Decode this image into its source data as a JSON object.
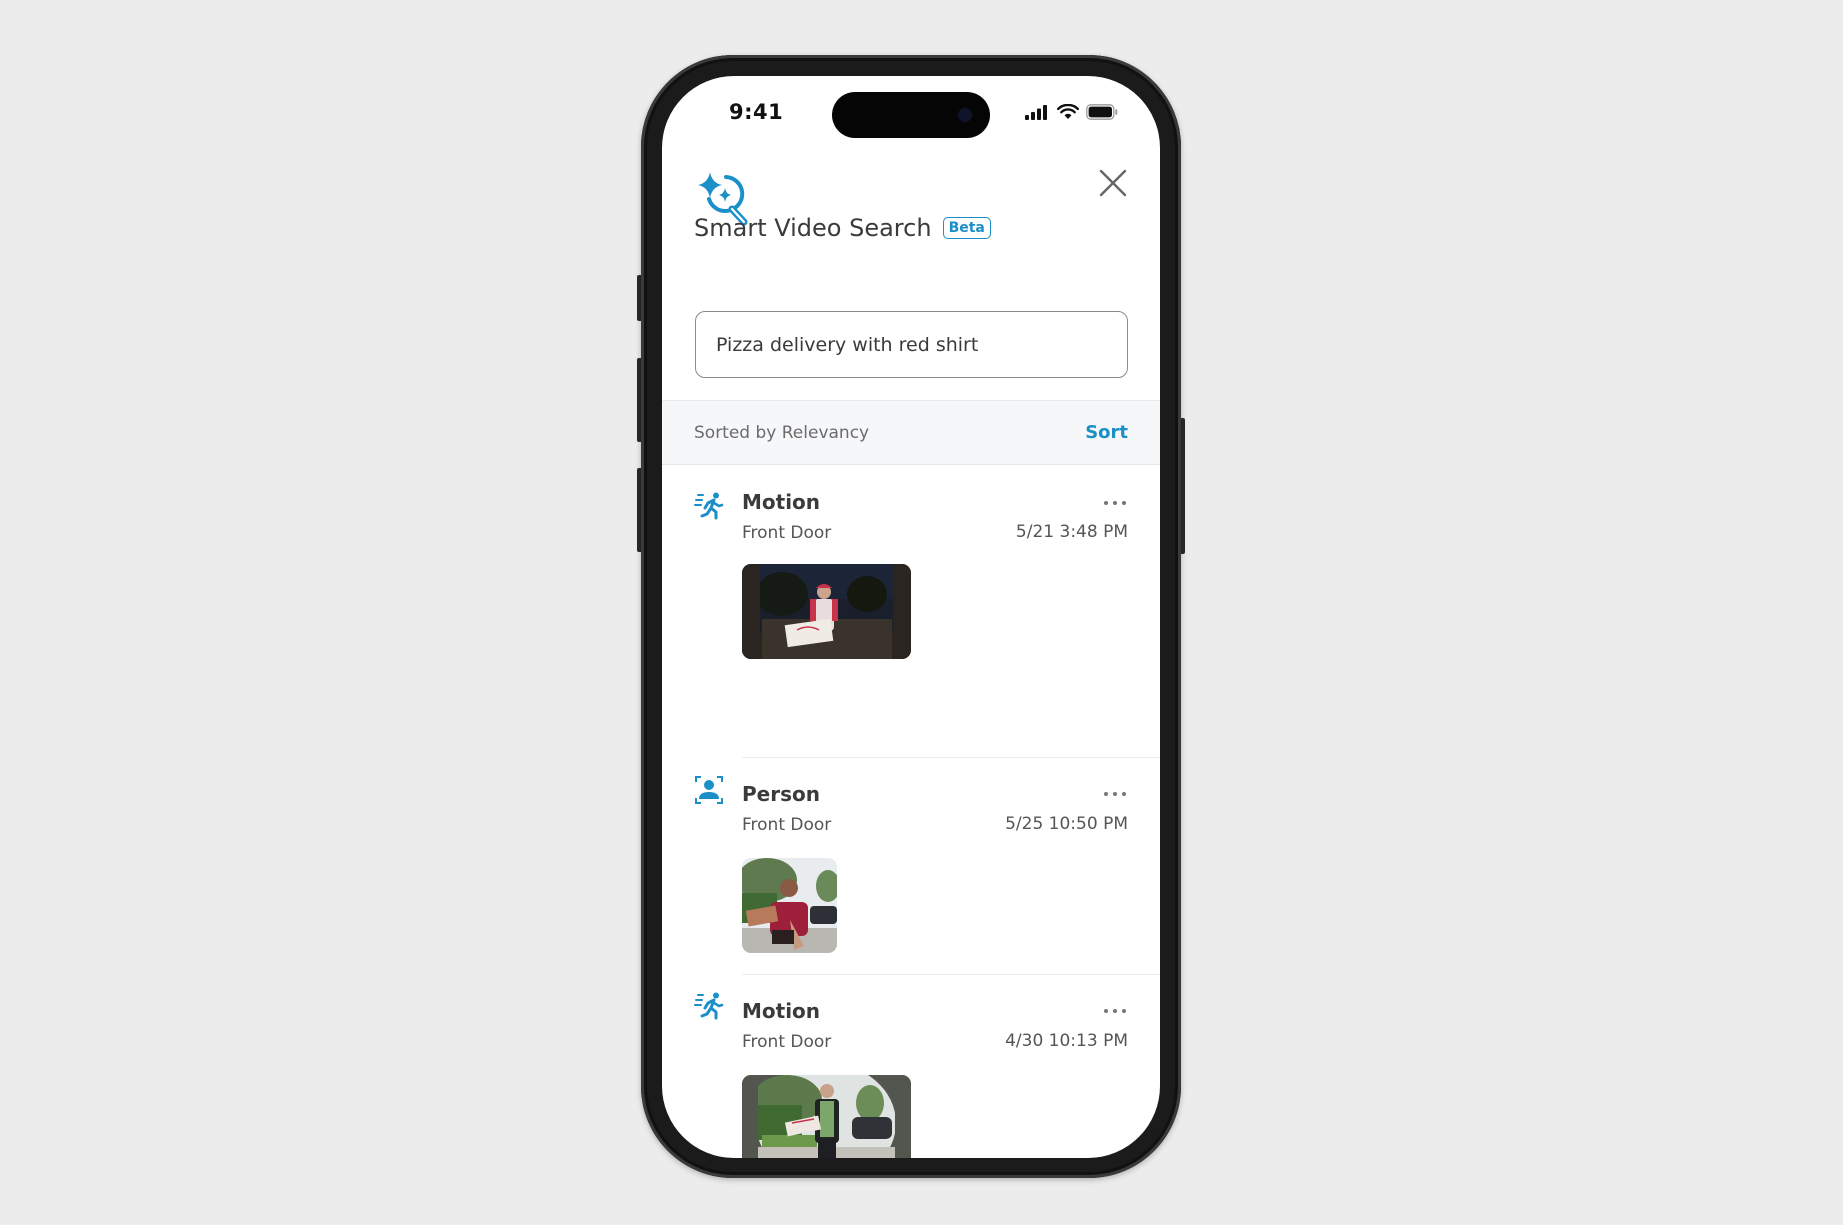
{
  "status_bar": {
    "time": "9:41"
  },
  "header": {
    "title": "Smart Video Search",
    "badge": "Beta",
    "logo_icon": "sparkle-search-icon",
    "close_icon": "close-icon"
  },
  "search": {
    "value": "Pizza delivery with red shirt",
    "placeholder": ""
  },
  "sort_bar": {
    "label": "Sorted by Relevancy",
    "sort_button": "Sort"
  },
  "colors": {
    "accent": "#1b8fc8",
    "text": "#3b3b3b",
    "sort_bar_bg": "#f6f7f9",
    "background": "#ececec"
  },
  "events": [
    {
      "type": "Motion",
      "icon": "running-person-icon",
      "location": "Front Door",
      "timestamp": "5/21 3:48 PM",
      "thumbnail": "night-doorbell-pizza-delivery"
    },
    {
      "type": "Person",
      "icon": "person-detect-icon",
      "location": "Front Door",
      "timestamp": "5/25 10:50 PM",
      "thumbnail": "day-doorbell-pizza-handoff"
    },
    {
      "type": "Motion",
      "icon": "running-person-icon",
      "location": "Front Door",
      "timestamp": "4/30 10:13 PM",
      "thumbnail": "day-doorbell-pizza-man"
    }
  ]
}
